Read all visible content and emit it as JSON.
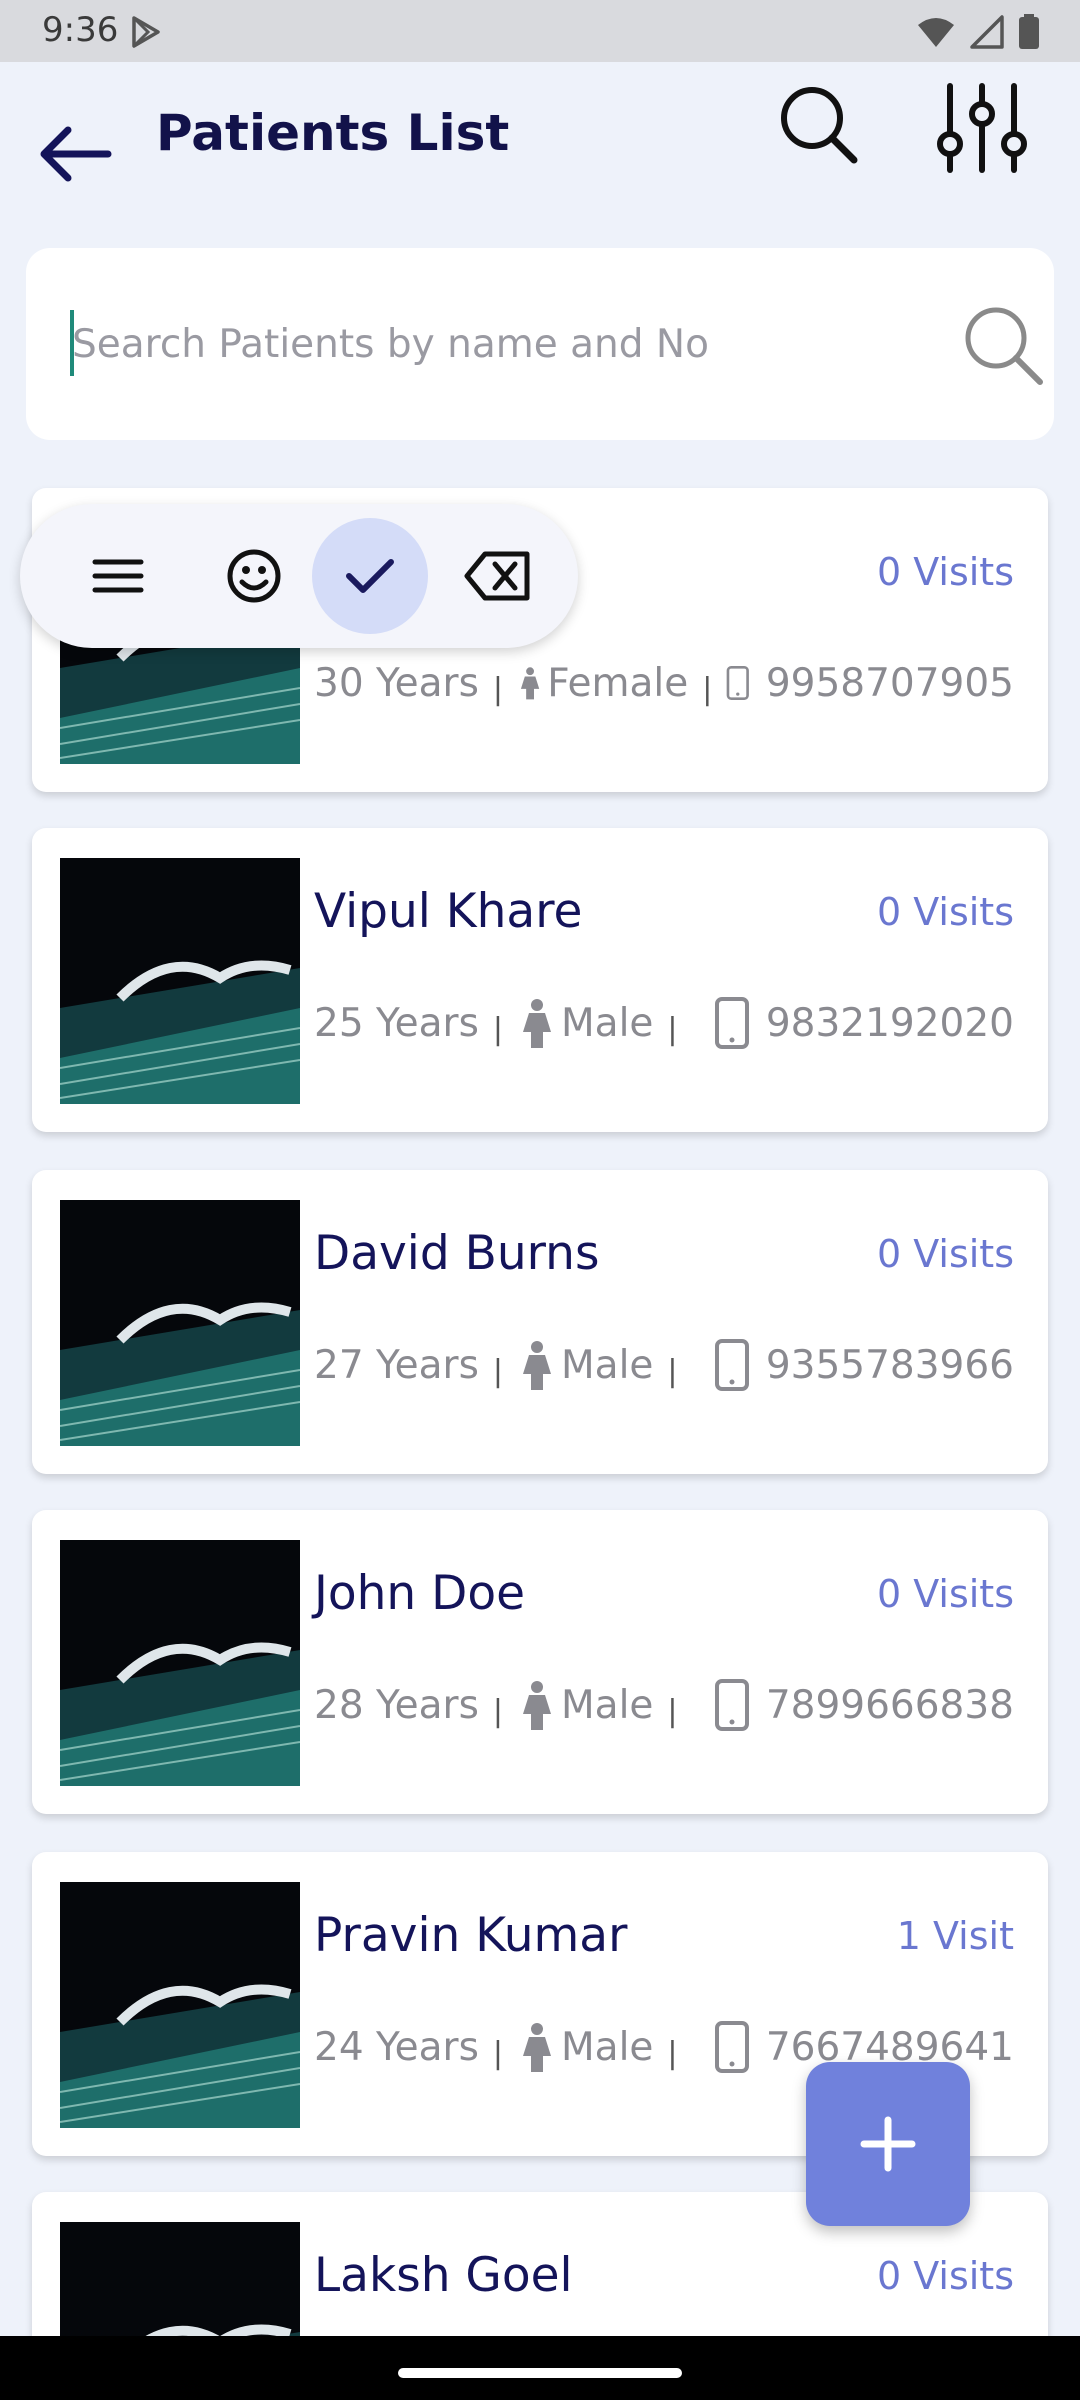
{
  "status_bar": {
    "time": "9:36",
    "icons": [
      "play-store-icon",
      "wifi-icon",
      "signal-icon",
      "battery-icon"
    ]
  },
  "header": {
    "title": "Patients List",
    "icons": [
      "back-arrow-icon",
      "search-icon",
      "filter-sliders-icon"
    ]
  },
  "search": {
    "placeholder": "Search Patients by name and No",
    "value": ""
  },
  "patients": [
    {
      "name": "",
      "visits": "0 Visits",
      "age": "30 Years",
      "gender": "Female",
      "phone": "9958707905"
    },
    {
      "name": "Vipul  Khare",
      "visits": "0 Visits",
      "age": "25 Years",
      "gender": "Male",
      "phone": "9832192020"
    },
    {
      "name": "David  Burns",
      "visits": "0 Visits",
      "age": "27 Years",
      "gender": "Male",
      "phone": "9355783966"
    },
    {
      "name": "John  Doe",
      "visits": "0 Visits",
      "age": "28 Years",
      "gender": "Male",
      "phone": "7899666838"
    },
    {
      "name": "Pravin  Kumar",
      "visits": "1 Visit",
      "age": "24 Years",
      "gender": "Male",
      "phone": "7667489641"
    },
    {
      "name": "Laksh  Goel",
      "visits": "0 Visits",
      "age": "",
      "gender": "",
      "phone": ""
    }
  ],
  "keyboard_toolbar": {
    "icons": [
      "menu-icon",
      "emoji-icon",
      "check-icon",
      "backspace-icon"
    ]
  },
  "fab": {
    "icon": "plus-icon"
  },
  "colors": {
    "accent": "#7081dc",
    "title": "#12124a",
    "visits": "#6a77d0",
    "background": "#eef2fa"
  }
}
